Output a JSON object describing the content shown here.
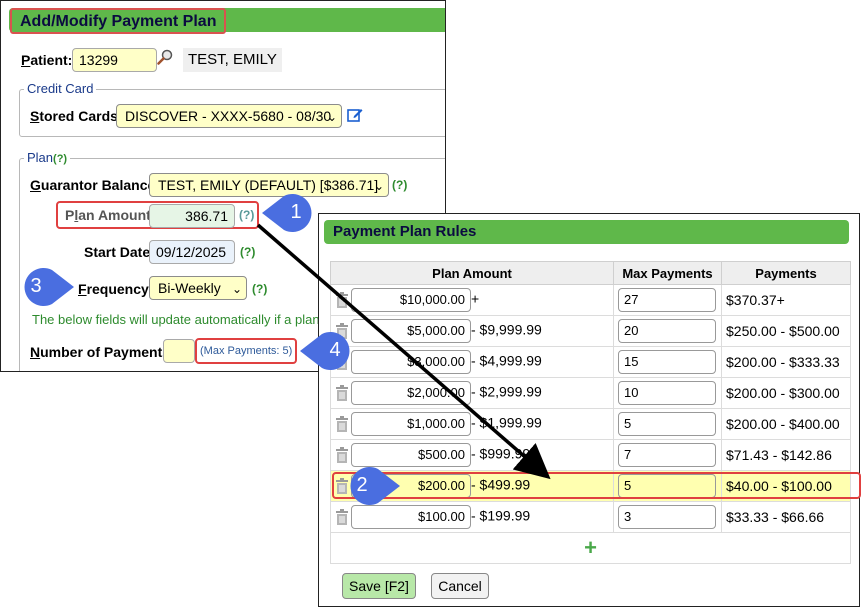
{
  "window1": {
    "title": "Add/Modify Payment Plan",
    "patient": {
      "label": "Patient:",
      "value": "13299",
      "name": "TEST, EMILY"
    },
    "credit_card": {
      "legend": "Credit Card",
      "stored_cards_label": "Stored Cards:",
      "stored_cards_value": "DISCOVER - XXXX-5680 - 08/30"
    },
    "plan": {
      "legend": "Plan",
      "help": "(?)",
      "guarantor_label": "Guarantor Balance:",
      "guarantor_value": "TEST, EMILY (DEFAULT) [$386.71]",
      "plan_amount_label": "Plan Amount:",
      "plan_amount_value": "386.71",
      "start_date_label": "Start Date:",
      "start_date_value": "09/12/2025",
      "frequency_label": "Frequency:",
      "frequency_value": "Bi-Weekly",
      "info_text": "The below fields will update automatically if a plan",
      "num_payments_label": "Number of Payments:",
      "num_payments_value": "",
      "max_payments_text": "(Max Payments: 5)"
    }
  },
  "window2": {
    "title": "Payment Plan Rules",
    "headers": [
      "Plan Amount",
      "Max Payments",
      "Payments"
    ],
    "rows": [
      {
        "amount": "$10,000.00",
        "range": "+",
        "max": "27",
        "payments": "$370.37+"
      },
      {
        "amount": "$5,000.00",
        "range": "- $9,999.99",
        "max": "20",
        "payments": "$250.00 - $500.00"
      },
      {
        "amount": "$3,000.00",
        "range": "- $4,999.99",
        "max": "15",
        "payments": "$200.00 - $333.33"
      },
      {
        "amount": "$2,000.00",
        "range": "- $2,999.99",
        "max": "10",
        "payments": "$200.00 - $300.00"
      },
      {
        "amount": "$1,000.00",
        "range": "- $1,999.99",
        "max": "5",
        "payments": "$200.00 - $400.00"
      },
      {
        "amount": "$500.00",
        "range": "- $999.99",
        "max": "7",
        "payments": "$71.43 - $142.86"
      },
      {
        "amount": "$200.00",
        "range": "- $499.99",
        "max": "5",
        "payments": "$40.00 - $100.00"
      },
      {
        "amount": "$100.00",
        "range": "- $199.99",
        "max": "3",
        "payments": "$33.33 - $66.66"
      }
    ],
    "add_symbol": "+",
    "save_label": "Save [F2]",
    "cancel_label": "Cancel"
  },
  "callouts": [
    "1",
    "2",
    "3",
    "4"
  ],
  "colors": {
    "title_bar": "#5fb84a",
    "highlight_red": "#e04040",
    "callout_blue": "#4a6ee0",
    "highlight_row": "#ffffb0"
  },
  "icons": [
    "search-icon",
    "edit-icon",
    "chevron-down-icon",
    "trash-icon",
    "plus-icon"
  ]
}
